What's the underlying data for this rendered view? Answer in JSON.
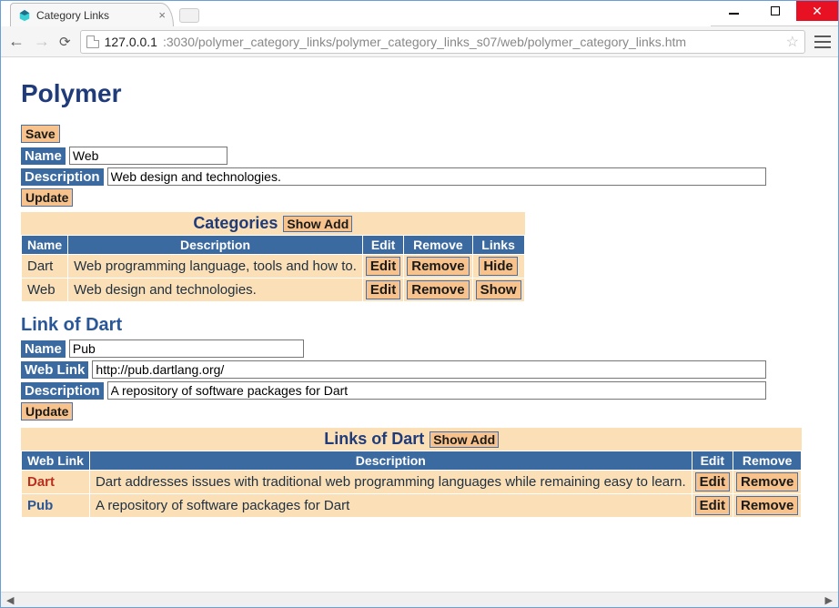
{
  "window": {
    "tab_title": "Category Links",
    "url_host": "127.0.0.1",
    "url_port_path": ":3030/polymer_category_links/polymer_category_links_s07/web/polymer_category_links.htm"
  },
  "page": {
    "title": "Polymer",
    "save_label": "Save"
  },
  "category_form": {
    "name_label": "Name",
    "name_value": "Web",
    "desc_label": "Description",
    "desc_value": "Web design and technologies.",
    "update_label": "Update"
  },
  "categories_section": {
    "title": "Categories",
    "show_add_label": "Show Add",
    "headers": {
      "name": "Name",
      "desc": "Description",
      "edit": "Edit",
      "remove": "Remove",
      "links": "Links"
    },
    "rows": [
      {
        "name": "Dart",
        "desc": "Web programming language, tools and how to.",
        "edit": "Edit",
        "remove": "Remove",
        "links": "Hide"
      },
      {
        "name": "Web",
        "desc": "Web design and technologies.",
        "edit": "Edit",
        "remove": "Remove",
        "links": "Show"
      }
    ]
  },
  "link_section": {
    "title": "Link of Dart",
    "name_label": "Name",
    "name_value": "Pub",
    "weblink_label": "Web Link",
    "weblink_value": "http://pub.dartlang.org/",
    "desc_label": "Description",
    "desc_value": "A repository of software packages for Dart",
    "update_label": "Update"
  },
  "links_table": {
    "title": "Links of Dart",
    "show_add_label": "Show Add",
    "headers": {
      "weblink": "Web Link",
      "desc": "Description",
      "edit": "Edit",
      "remove": "Remove"
    },
    "rows": [
      {
        "weblink": "Dart",
        "desc": "Dart addresses issues with traditional web programming languages while remaining easy to learn.",
        "edit": "Edit",
        "remove": "Remove"
      },
      {
        "weblink": "Pub",
        "desc": "A repository of software packages for Dart",
        "edit": "Edit",
        "remove": "Remove"
      }
    ]
  }
}
